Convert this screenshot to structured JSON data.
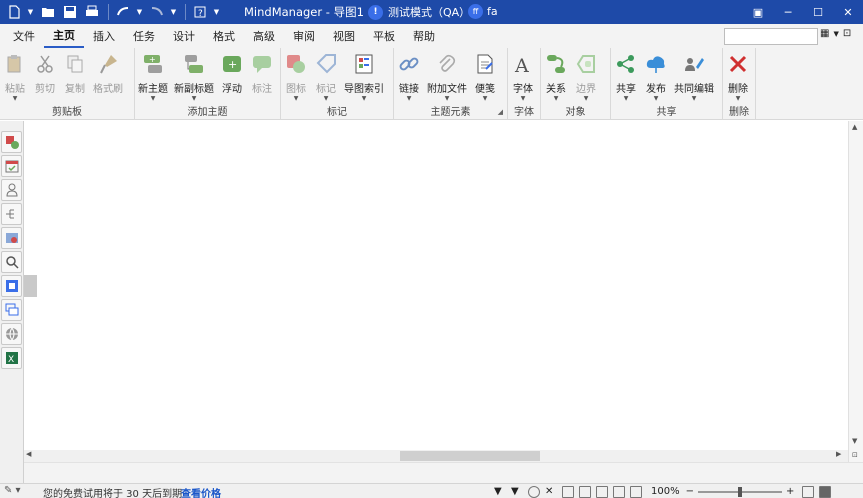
{
  "titlebar": {
    "app_title": "MindManager - 导图1",
    "mode_initial": "!",
    "mode_label": "测试模式（QA）",
    "user_initials": "ff",
    "user_label": "fa",
    "colors": {
      "bar": "#1e4aa8",
      "badge": "#3a6ee8"
    }
  },
  "menu": {
    "tabs": [
      {
        "label": "文件"
      },
      {
        "label": "主页",
        "active": true
      },
      {
        "label": "插入"
      },
      {
        "label": "任务"
      },
      {
        "label": "设计"
      },
      {
        "label": "格式"
      },
      {
        "label": "高级"
      },
      {
        "label": "审阅"
      },
      {
        "label": "视图"
      },
      {
        "label": "平板"
      },
      {
        "label": "帮助"
      }
    ],
    "search_value": ""
  },
  "ribbon": {
    "groups": [
      {
        "label": "剪贴板",
        "buttons": [
          "粘贴",
          "剪切",
          "复制",
          "格式刷"
        ]
      },
      {
        "label": "添加主题",
        "buttons": [
          "新主题",
          "新副标题",
          "浮动",
          "标注"
        ]
      },
      {
        "label": "标记",
        "buttons": [
          "图标",
          "标记",
          "导图索引"
        ]
      },
      {
        "label": "主题元素",
        "buttons": [
          "链接",
          "附加文件",
          "便笺"
        ]
      },
      {
        "label": "字体",
        "buttons": [
          "字体"
        ]
      },
      {
        "label": "对象",
        "buttons": [
          "关系",
          "边界"
        ]
      },
      {
        "label": "共享",
        "buttons": [
          "共享",
          "发布",
          "共同编辑"
        ]
      },
      {
        "label": "删除",
        "buttons": [
          "删除"
        ]
      }
    ]
  },
  "status": {
    "trial_text": "您的免费试用将于 30 天后到期",
    "pricing_link": "查看价格",
    "zoom": "100%",
    "zoom_level": 0.5
  }
}
